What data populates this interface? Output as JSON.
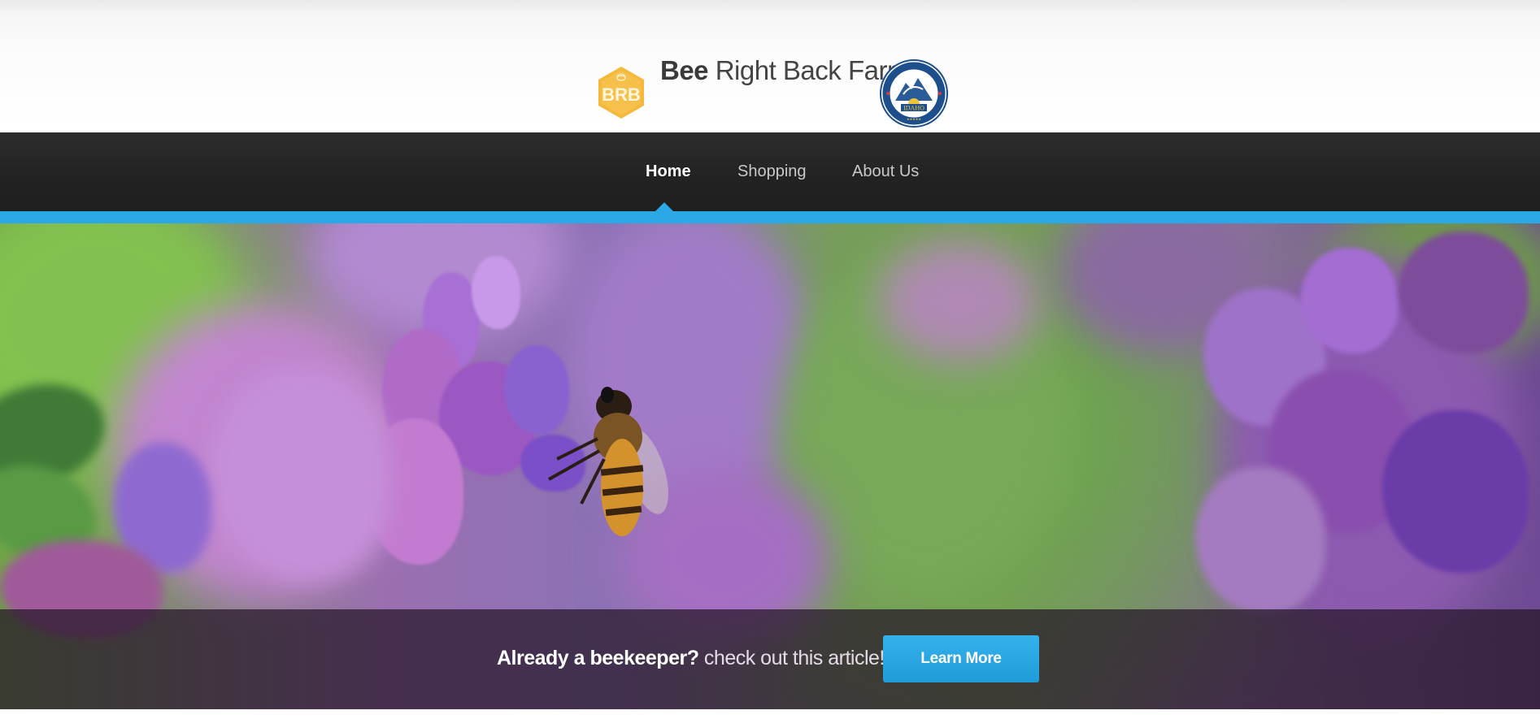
{
  "header": {
    "logo_text": "BRB",
    "title_bold": "Bee",
    "title_light": " Right Back Farms",
    "seal_text": "HOMEGROWN BY HEROES IDAHO"
  },
  "nav": {
    "items": [
      {
        "label": "Home",
        "active": true
      },
      {
        "label": "Shopping",
        "active": false
      },
      {
        "label": "About Us",
        "active": false
      }
    ]
  },
  "hero": {
    "cta_bold": "Already a beekeeper?",
    "cta_light": " check out this article!",
    "button_label": "Learn More"
  },
  "colors": {
    "accent": "#2aa9e6",
    "nav_bg": "#222222",
    "logo_gold": "#f5b83c",
    "seal_blue": "#1c4f8c"
  }
}
